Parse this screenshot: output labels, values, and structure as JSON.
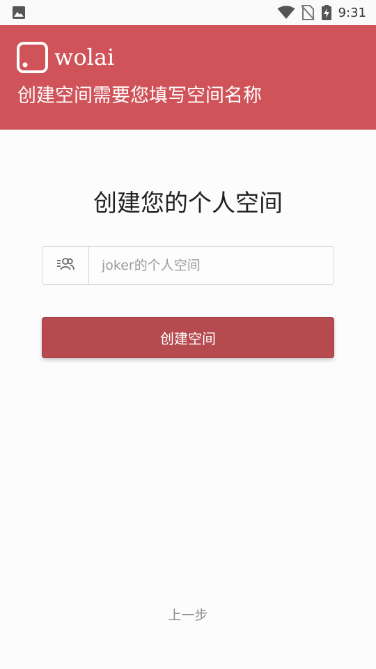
{
  "status_bar": {
    "time": "9:31",
    "icons": [
      "image-icon",
      "wifi-icon",
      "no-sim-icon",
      "battery-charging-icon"
    ]
  },
  "header": {
    "brand": "wolai",
    "subtitle": "创建空间需要您填写空间名称",
    "background_color": "#cf5358"
  },
  "main": {
    "title": "创建您的个人空间",
    "space_name_input": {
      "value": "",
      "placeholder": "joker的个人空间",
      "icon": "team-icon"
    },
    "create_button_label": "创建空间",
    "button_color": "#b54a4f"
  },
  "footer": {
    "back_label": "上一步"
  }
}
